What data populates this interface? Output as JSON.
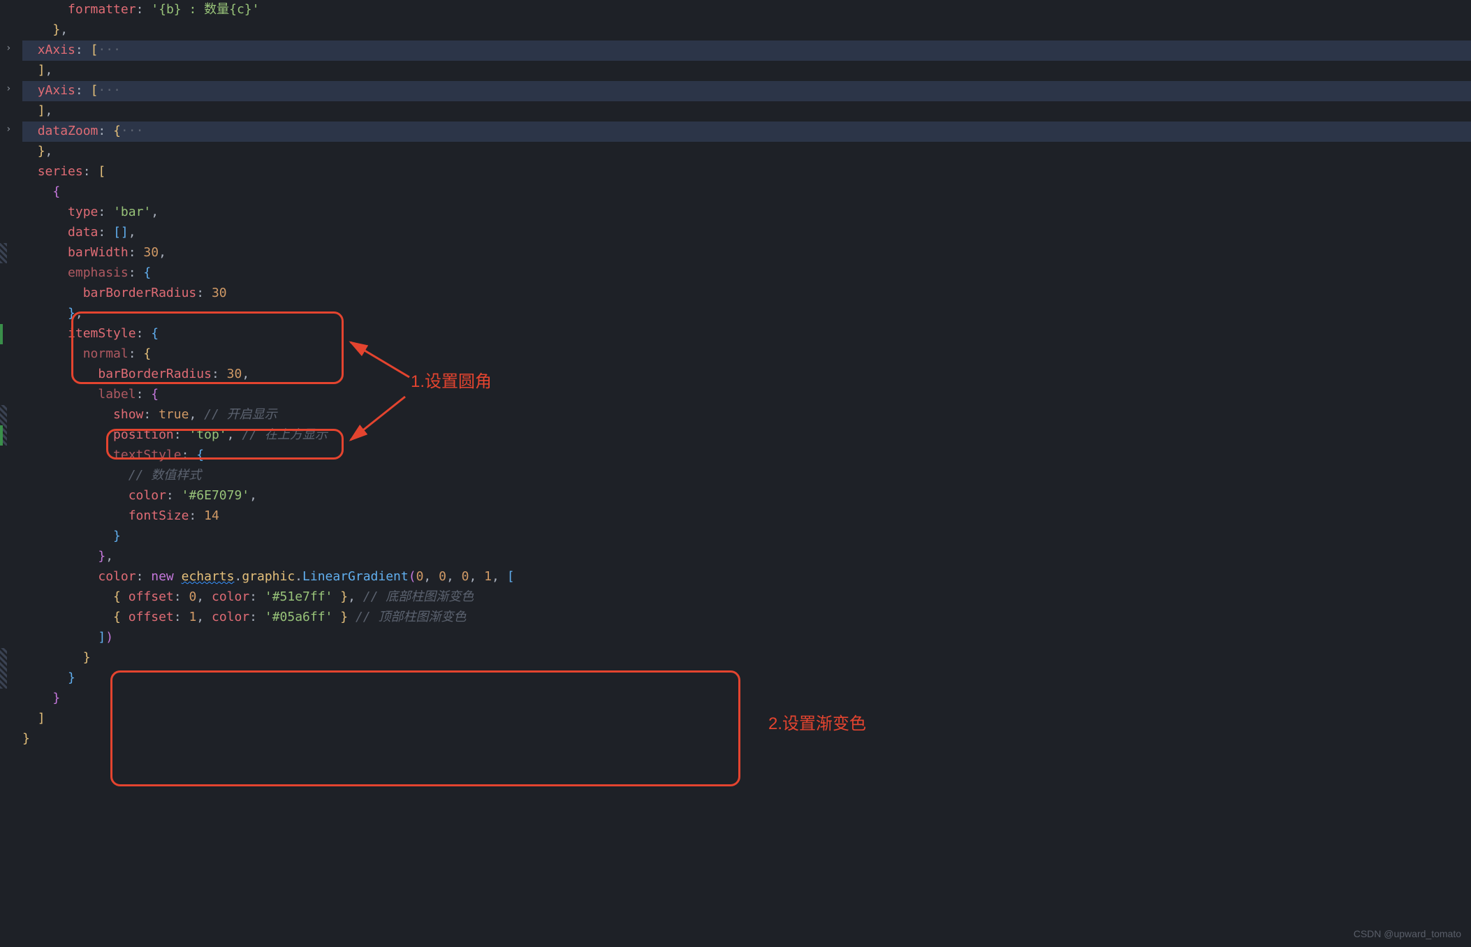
{
  "code": {
    "l1": {
      "key": "formatter",
      "val": "'{b} : 数量{c}'"
    },
    "l2": "  },",
    "l3": {
      "key": "xAxis",
      "open": ": [",
      "dots": "···"
    },
    "l4": "  ],",
    "l5": {
      "key": "yAxis",
      "open": ": [",
      "dots": "···"
    },
    "l6": "  ],",
    "l7": {
      "key": "dataZoom",
      "open": ": {",
      "dots": "···"
    },
    "l8": "  },",
    "l9": {
      "key": "series",
      "open": ": ["
    },
    "l10": "    {",
    "l11": {
      "key": "type",
      "val": "'bar'",
      "tail": ","
    },
    "l12": {
      "key": "data",
      "val": "[]",
      "tail": ","
    },
    "l13": {
      "key": "barWidth",
      "val": "30",
      "tail": ","
    },
    "l14": {
      "key": "emphasis",
      "open": ": {"
    },
    "l15": {
      "key": "barBorderRadius",
      "val": "30"
    },
    "l16": "      },",
    "l17": {
      "key": "itemStyle",
      "open": ": {"
    },
    "l18": {
      "key": "normal",
      "open": ": {"
    },
    "l19": {
      "key": "barBorderRadius",
      "val": "30",
      "tail": ","
    },
    "l20": {
      "key": "label",
      "open": ": {"
    },
    "l21": {
      "key": "show",
      "val": "true",
      "tail": ",",
      "comment": "// 开启显示"
    },
    "l22": {
      "key": "position",
      "val": "'top'",
      "tail": ",",
      "comment": "// 在上方显示"
    },
    "l23": {
      "key": "textStyle",
      "open": ": {"
    },
    "l24": {
      "comment": "// 数值样式"
    },
    "l25": {
      "key": "color",
      "val": "'#6E7079'",
      "tail": ","
    },
    "l26": {
      "key": "fontSize",
      "val": "14"
    },
    "l27": "            }",
    "l28": "          },",
    "l29": {
      "key": "color",
      "kw": "new",
      "obj1": "echarts",
      "obj2": "graphic",
      "fn": "LinearGradient",
      "args": "(0, 0, 0, 1, ["
    },
    "l30": {
      "open": "{ ",
      "k1": "offset",
      "v1": "0",
      "k2": "color",
      "v2": "'#51e7ff'",
      "close": " },",
      "comment": "// 底部柱图渐变色"
    },
    "l31": {
      "open": "{ ",
      "k1": "offset",
      "v1": "1",
      "k2": "color",
      "v2": "'#05a6ff'",
      "close": " }",
      "comment": "// 顶部柱图渐变色"
    },
    "l32": "          ])",
    "l33": "        }",
    "l34": "      }",
    "l35": "    }",
    "l36": "  ]",
    "l37": "}"
  },
  "annotations": {
    "label1": "1.设置圆角",
    "label2": "2.设置渐变色"
  },
  "watermark": "CSDN @upward_tomato"
}
